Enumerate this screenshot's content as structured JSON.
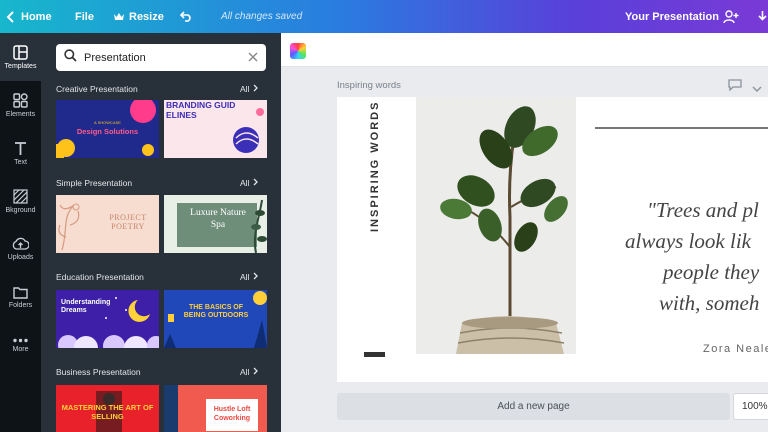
{
  "topbar": {
    "home_label": "Home",
    "file_label": "File",
    "resize_label": "Resize",
    "saved_status": "All changes saved",
    "presentation_name": "Your Presentation"
  },
  "rail": {
    "items": [
      {
        "label": "Templates",
        "icon": "templates-icon"
      },
      {
        "label": "Elements",
        "icon": "elements-icon"
      },
      {
        "label": "Text",
        "icon": "text-icon"
      },
      {
        "label": "Bkground",
        "icon": "background-icon"
      },
      {
        "label": "Uploads",
        "icon": "uploads-icon"
      },
      {
        "label": "Folders",
        "icon": "folders-icon"
      },
      {
        "label": "More",
        "icon": "more-icon"
      }
    ]
  },
  "search": {
    "value": "Presentation"
  },
  "sections": [
    {
      "title": "Creative Presentation",
      "all_label": "All",
      "thumbs": [
        {
          "title": "Design Solutions",
          "small": "A SHOWCASE"
        },
        {
          "title": "BRANDING GUIDELINES"
        }
      ]
    },
    {
      "title": "Simple Presentation",
      "all_label": "All",
      "thumbs": [
        {
          "title": "PROJECT POETRY"
        },
        {
          "title": "Luxure Nature Spa"
        }
      ]
    },
    {
      "title": "Education Presentation",
      "all_label": "All",
      "thumbs": [
        {
          "title": "Understanding Dreams"
        },
        {
          "title": "THE BASICS OF BEING OUTDOORS"
        }
      ]
    },
    {
      "title": "Business Presentation",
      "all_label": "All",
      "thumbs": [
        {
          "title": "MASTERING THE ART OF SELLING"
        },
        {
          "title": "Hustle Loft Coworking"
        }
      ]
    }
  ],
  "editor": {
    "page_label": "Inspiring words",
    "vertical_title": "INSPIRING WORDS",
    "quote_lines": [
      "\"Trees and pl",
      "always look lik",
      "people they",
      "with, someh"
    ],
    "author": "Zora Neale",
    "add_page_label": "Add a new page",
    "zoom_label": "100%"
  },
  "colors": {
    "rail_bg": "#0e1318",
    "panel_bg": "#283039",
    "accent_gradient_start": "#17b7cc",
    "accent_gradient_end": "#7a3ad6"
  }
}
